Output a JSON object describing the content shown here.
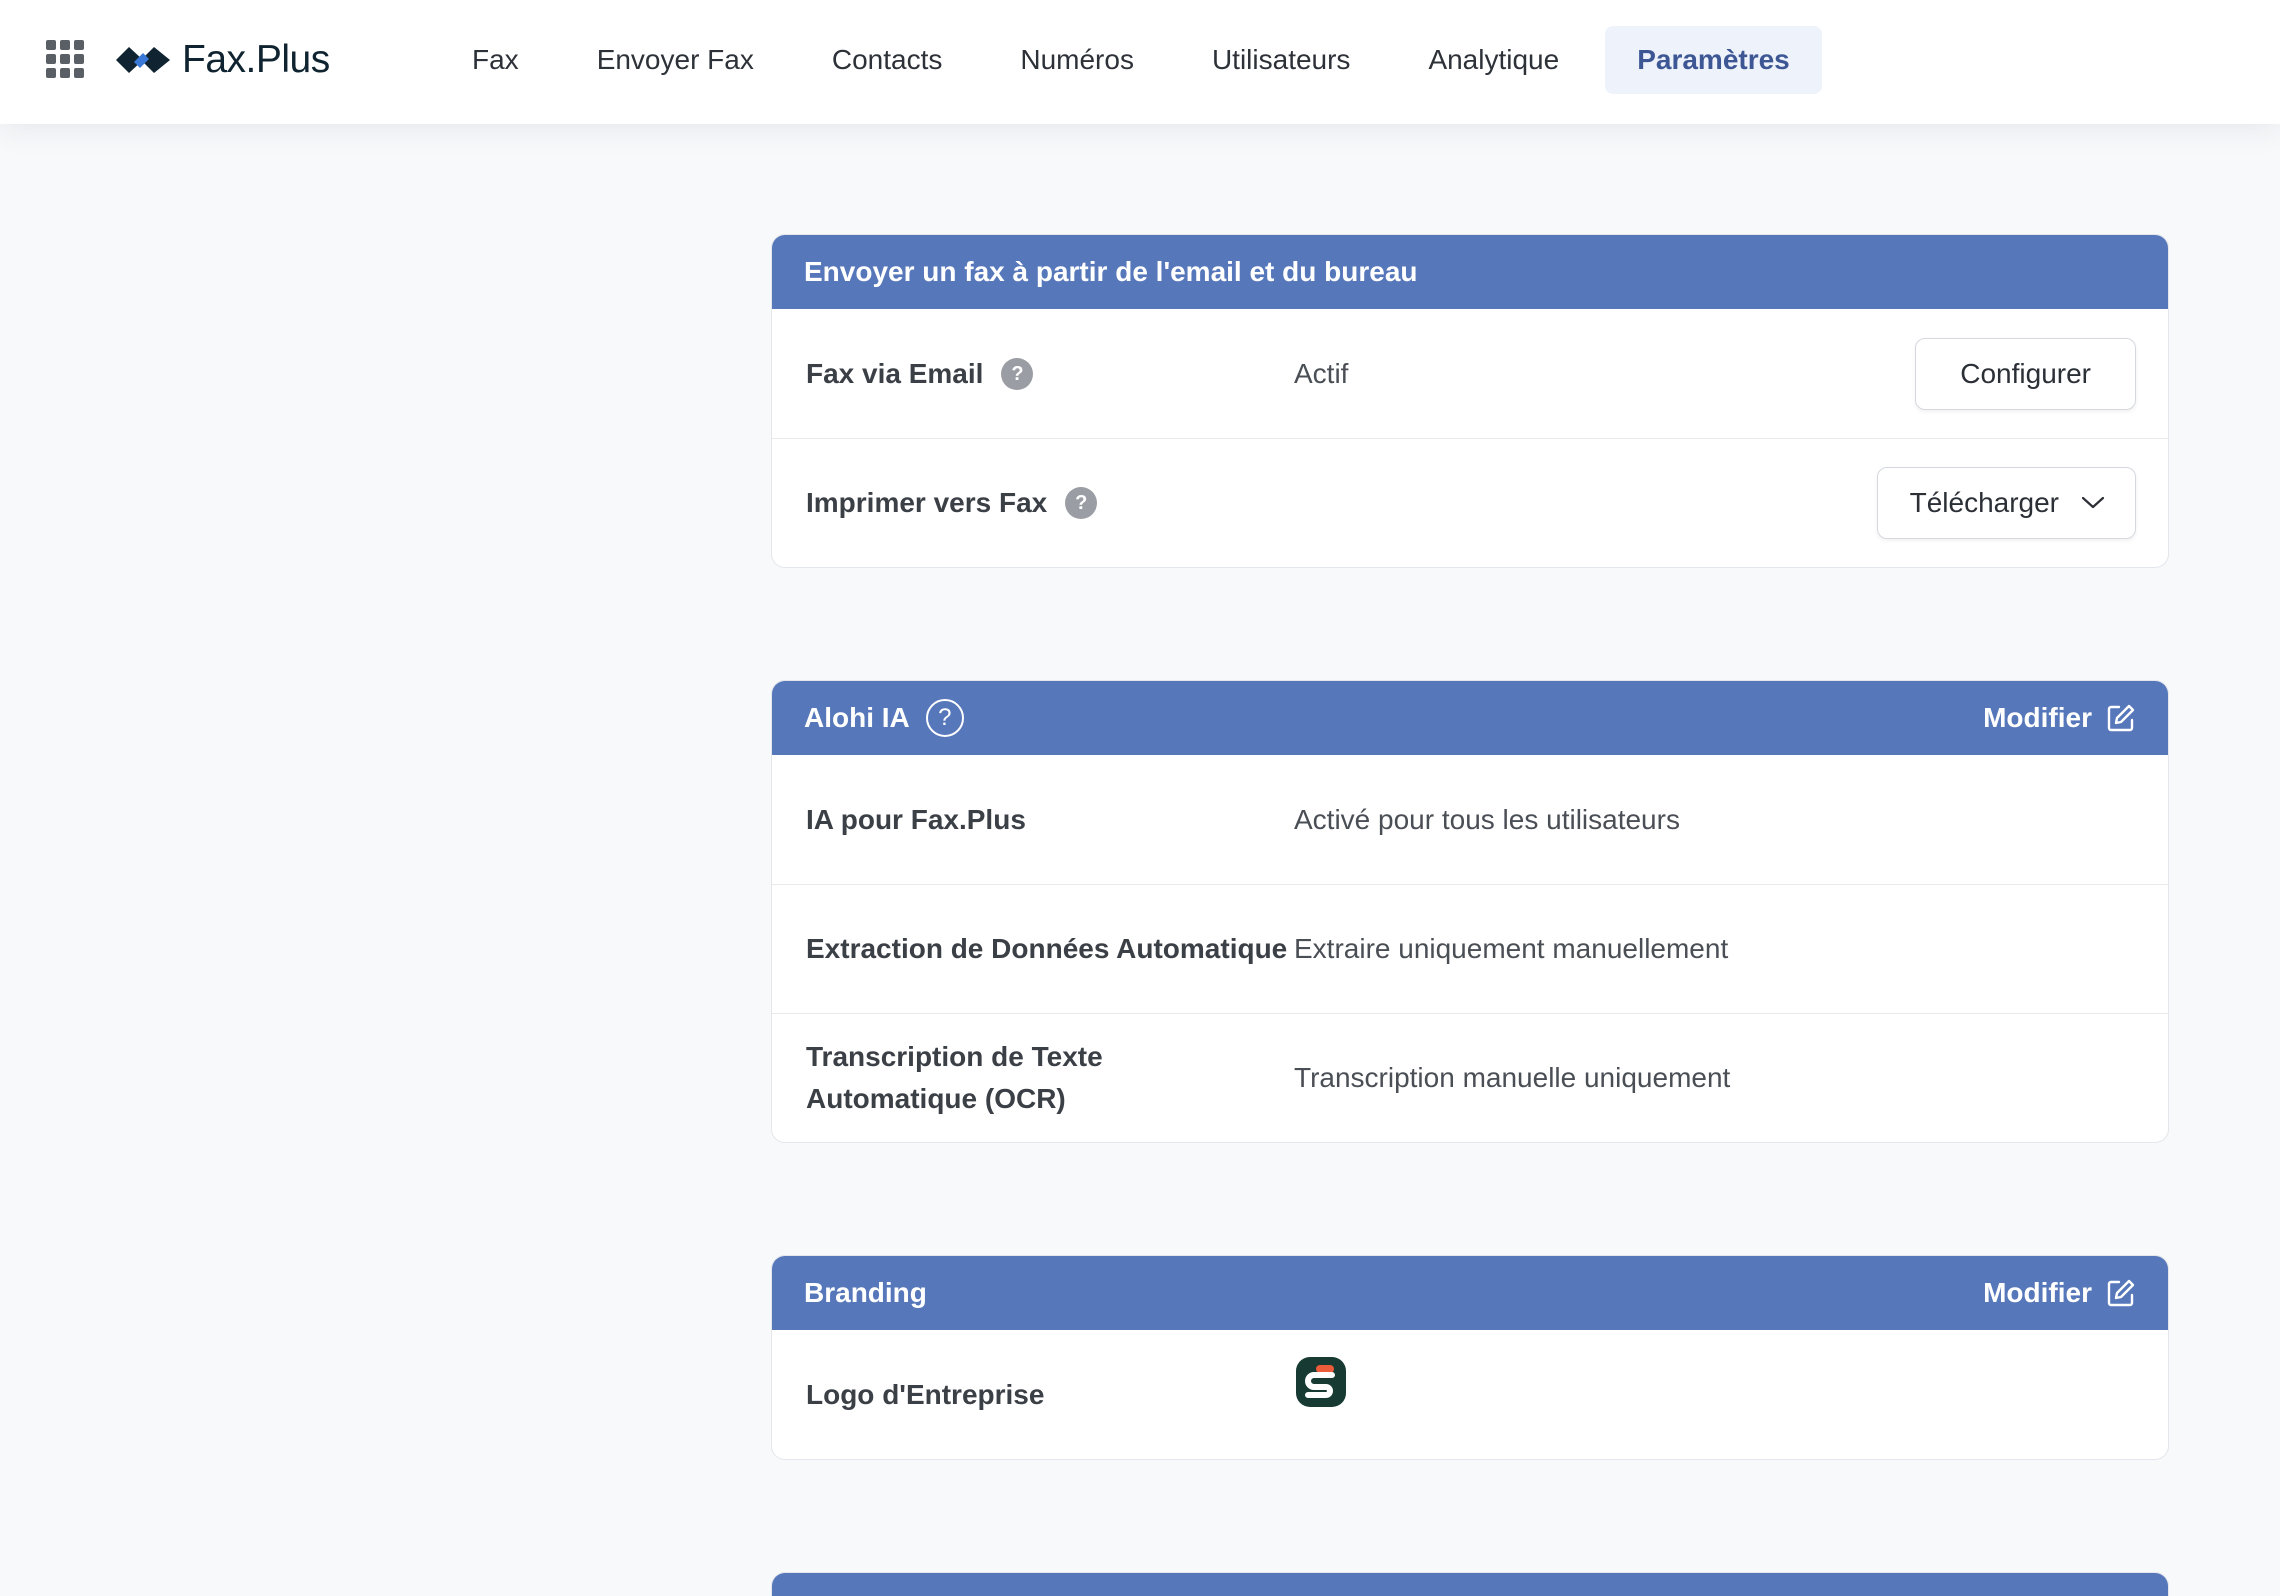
{
  "app": {
    "name": "Fax.Plus"
  },
  "nav": {
    "items": [
      {
        "label": "Fax",
        "active": false
      },
      {
        "label": "Envoyer Fax",
        "active": false
      },
      {
        "label": "Contacts",
        "active": false
      },
      {
        "label": "Numéros",
        "active": false
      },
      {
        "label": "Utilisateurs",
        "active": false
      },
      {
        "label": "Analytique",
        "active": false
      },
      {
        "label": "Paramètres",
        "active": true
      }
    ]
  },
  "send_section": {
    "title": "Envoyer un fax à partir de l'email et du bureau",
    "rows": [
      {
        "label": "Fax via Email",
        "help": "?",
        "value": "Actif",
        "button": "Configurer"
      },
      {
        "label": "Imprimer vers Fax",
        "help": "?",
        "value": "",
        "button": "Télécharger"
      }
    ]
  },
  "ai_section": {
    "title": "Alohi IA",
    "help": "?",
    "edit_label": "Modifier",
    "rows": [
      {
        "label": "IA pour Fax.Plus",
        "value": "Activé pour tous les utilisateurs"
      },
      {
        "label": "Extraction de Données Automatique",
        "value": "Extraire uniquement manuellement"
      },
      {
        "label": "Transcription de Texte Automatique (OCR)",
        "value": "Transcription manuelle uniquement"
      }
    ]
  },
  "branding_section": {
    "title": "Branding",
    "edit_label": "Modifier",
    "rows": [
      {
        "label": "Logo d'Entreprise"
      }
    ]
  },
  "icons": {
    "apps": "grid-icon",
    "help": "question-icon",
    "edit": "edit-icon",
    "chevron": "chevron-down-icon"
  },
  "colors": {
    "accent": "#5677ba",
    "active_nav_bg": "#eef2fa",
    "active_nav_text": "#3d5795",
    "background": "#f8f9fb"
  }
}
